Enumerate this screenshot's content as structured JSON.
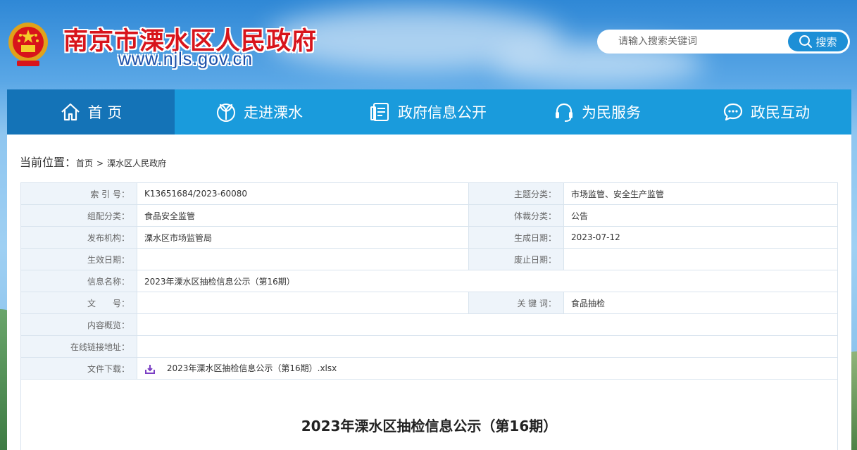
{
  "header": {
    "site_title": "南京市溧水区人民政府",
    "site_url": "www.njls.gov.cn",
    "search_placeholder": "请输入搜索关键词",
    "search_button": "搜索"
  },
  "nav": {
    "items": [
      {
        "label": "首 页",
        "icon": "home-icon"
      },
      {
        "label": "走进溧水",
        "icon": "leaf-icon"
      },
      {
        "label": "政府信息公开",
        "icon": "document-icon"
      },
      {
        "label": "为民服务",
        "icon": "headset-icon"
      },
      {
        "label": "政民互动",
        "icon": "chat-icon"
      }
    ]
  },
  "breadcrumb": {
    "label": "当前位置：",
    "items": [
      "首页",
      "溧水区人民政府"
    ],
    "separator": ">"
  },
  "meta": {
    "index_no_label": "索 引 号：",
    "index_no": "K13651684/2023-60080",
    "topic_label": "主题分类：",
    "topic": "市场监管、安全生产监管",
    "group_label": "组配分类：",
    "group": "食品安全监管",
    "genre_label": "体裁分类：",
    "genre": "公告",
    "publisher_label": "发布机构：",
    "publisher": "溧水区市场监管局",
    "created_label": "生成日期：",
    "created": "2023-07-12",
    "effective_label": "生效日期：",
    "effective": "",
    "abolished_label": "废止日期：",
    "abolished": "",
    "name_label": "信息名称：",
    "name": "2023年溧水区抽检信息公示（第16期）",
    "doc_no_label": "文　　号：",
    "doc_no": "",
    "keywords_label": "关 键 词：",
    "keywords": "食品抽检",
    "summary_label": "内容概览：",
    "summary": "",
    "link_label": "在线链接地址：",
    "link": "",
    "download_label": "文件下载：",
    "download_file": "2023年溧水区抽检信息公示（第16期）.xlsx"
  },
  "article": {
    "title": "2023年溧水区抽检信息公示（第16期）"
  },
  "colors": {
    "nav_bg": "#1a9bdc",
    "nav_active": "#1473b7",
    "title_red": "#d8141b",
    "url_blue": "#1a4ea8"
  }
}
